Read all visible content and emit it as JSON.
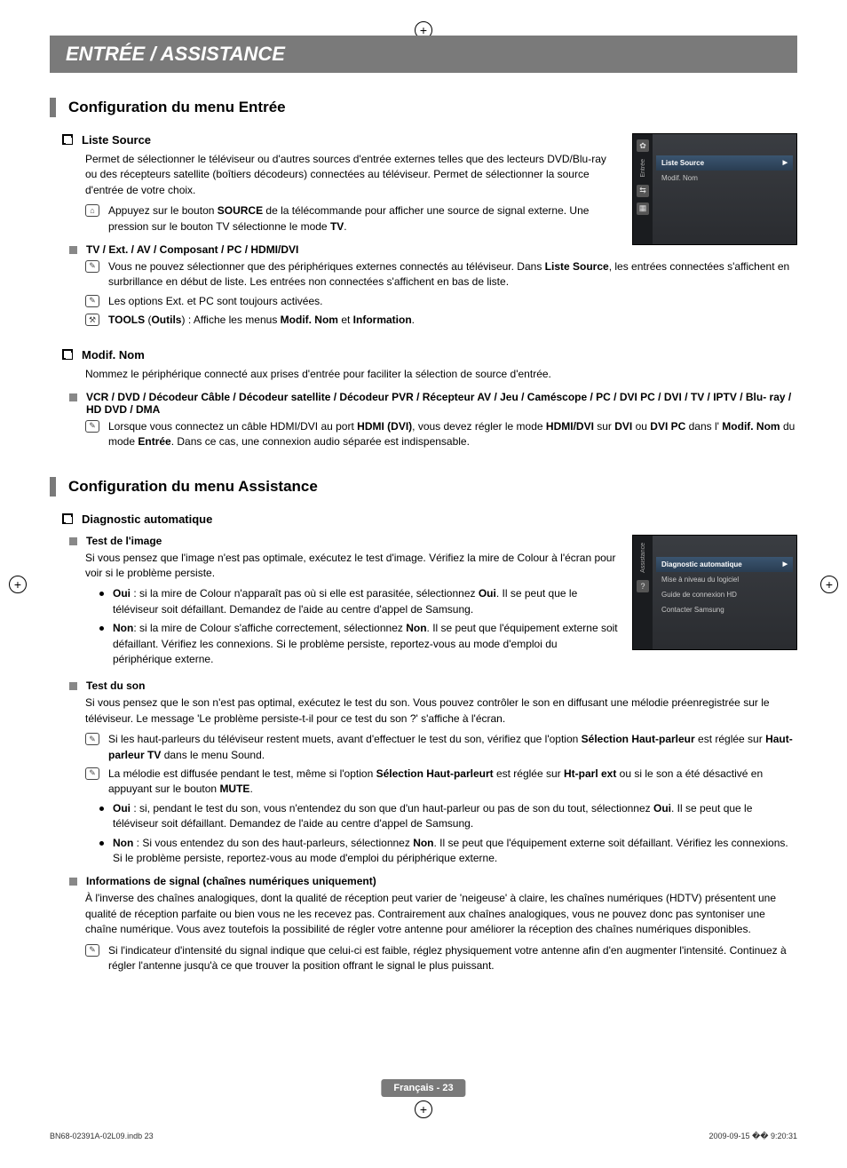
{
  "banner": "ENTRÉE / ASSISTANCE",
  "section1": {
    "title": "Configuration du menu Entrée",
    "listeSource": {
      "heading": "Liste Source",
      "intro": "Permet de sélectionner le téléviseur ou d'autres sources d'entrée externes telles que des lecteurs DVD/Blu-ray ou des récepteurs satellite (boîtiers décodeurs) connectées au téléviseur. Permet de sélectionner la source d'entrée de votre choix.",
      "note1_pre": "Appuyez sur le bouton ",
      "note1_bold": "SOURCE",
      "note1_mid": " de la télécommande pour afficher une source de signal externe. Une pression sur le bouton TV sélectionne le mode ",
      "note1_bold2": "TV",
      "note1_end": "."
    },
    "tvExt": {
      "heading": "TV / Ext. / AV / Composant / PC / HDMI/DVI",
      "note1_pre": "Vous ne pouvez sélectionner que des périphériques externes connectés au téléviseur. Dans ",
      "note1_bold": "Liste Source",
      "note1_post": ", les entrées connectées s'affichent en surbrillance en début de liste. Les entrées non connectées s'affichent en bas de liste.",
      "note2": "Les options Ext. et PC sont toujours activées.",
      "note3_b1": "TOOLS",
      "note3_p1": " (",
      "note3_b2": "Outils",
      "note3_p2": ") : Affiche les menus ",
      "note3_b3": "Modif. Nom",
      "note3_p3": " et ",
      "note3_b4": "Information",
      "note3_p4": "."
    },
    "modifNom": {
      "heading": "Modif. Nom",
      "intro": "Nommez le périphérique connecté aux prises d'entrée pour faciliter la sélection de source d'entrée.",
      "list": "VCR / DVD / Décodeur Câble / Décodeur satellite / Décodeur PVR / Récepteur AV / Jeu / Caméscope / PC / DVI PC / DVI / TV / IPTV / Blu- ray / HD DVD / DMA",
      "note_pre": "Lorsque vous connectez un câble HDMI/DVI au port ",
      "note_b1": "HDMI (DVI)",
      "note_p1": ", vous devez régler le mode ",
      "note_b2": "HDMI/DVI",
      "note_p2": " sur ",
      "note_b3": "DVI",
      "note_p3": " ou ",
      "note_b4": "DVI PC",
      "note_p4": " dans l' ",
      "note_b5": "Modif. Nom",
      "note_p5": " du mode ",
      "note_b6": "Entrée",
      "note_p6": ". Dans ce cas, une connexion audio séparée est indispensable."
    },
    "menu": {
      "tabLabel": "Entrée",
      "item1": "Liste Source",
      "item2": "Modif. Nom"
    }
  },
  "section2": {
    "title": "Configuration du menu Assistance",
    "diag": {
      "heading": "Diagnostic automatique"
    },
    "testImage": {
      "heading": "Test de l'image",
      "intro": "Si vous pensez que l'image n'est pas optimale, exécutez le test d'image. Vérifiez la mire de Colour à l'écran pour voir si le problème persiste.",
      "oui_b": "Oui",
      "oui_t": " : si la mire de Colour n'apparaît pas où si elle est parasitée, sélectionnez ",
      "oui_b2": "Oui",
      "oui_t2": ". Il se peut que le téléviseur soit défaillant. Demandez de l'aide au centre d'appel de Samsung.",
      "non_b": "Non",
      "non_t": ": si la mire de Colour s'affiche correctement, sélectionnez ",
      "non_b2": "Non",
      "non_t2": ". Il se peut que l'équipement externe soit défaillant. Vérifiez les connexions. Si le problème persiste, reportez-vous au mode d'emploi du périphérique externe."
    },
    "testSon": {
      "heading": "Test du son",
      "intro": "Si vous pensez que le son n'est pas optimal, exécutez le test du son. Vous pouvez contrôler le son en diffusant une mélodie préenregistrée sur le téléviseur. Le message 'Le problème persiste-t-il pour ce test du son ?' s'affiche à l'écran.",
      "n1_pre": "Si les haut-parleurs du téléviseur restent muets, avant d'effectuer le test du son, vérifiez que l'option ",
      "n1_b1": "Sélection Haut-parleur",
      "n1_p1": " est réglée sur ",
      "n1_b2": "Haut-parleur TV",
      "n1_p2": " dans le menu Sound.",
      "n2_pre": "La mélodie est diffusée pendant le test, même si l'option ",
      "n2_b1": "Sélection Haut-parleurt",
      "n2_p1": " est réglée sur ",
      "n2_b2": "Ht-parl ext",
      "n2_p2": " ou si le son a été désactivé en appuyant sur le bouton ",
      "n2_b3": "MUTE",
      "n2_p3": ".",
      "oui_b": "Oui",
      "oui_t": " : si, pendant le test du son, vous n'entendez du son que d'un haut-parleur ou pas de son du tout, sélectionnez ",
      "oui_b2": "Oui",
      "oui_t2": ". Il se peut que le téléviseur soit défaillant. Demandez de l'aide au centre d'appel de Samsung.",
      "non_b": "Non",
      "non_t": " : Si vous entendez du son des haut-parleurs, sélectionnez ",
      "non_b2": "Non",
      "non_t2": ". Il se peut que l'équipement externe soit défaillant. Vérifiez les connexions. Si le problème persiste, reportez-vous au mode d'emploi du périphérique externe."
    },
    "infoSignal": {
      "heading": "Informations de signal (chaînes numériques uniquement)",
      "intro": "À l'inverse des chaînes analogiques, dont la qualité de réception peut varier de 'neigeuse' à claire, les chaînes numériques (HDTV) présentent une qualité de réception parfaite ou bien vous ne les recevez pas. Contrairement aux chaînes analogiques, vous ne pouvez donc pas syntoniser une chaîne numérique. Vous avez toutefois la possibilité de régler votre antenne pour améliorer la réception des chaînes numériques disponibles.",
      "note": "Si l'indicateur d'intensité du signal indique que celui-ci est faible, réglez physiquement votre antenne afin d'en augmenter l'intensité. Continuez à régler l'antenne jusqu'à ce que trouver la position offrant le signal le plus puissant."
    },
    "menu": {
      "tabLabel": "Assistance",
      "item1": "Diagnostic automatique",
      "item2": "Mise à niveau du logiciel",
      "item3": "Guide de connexion HD",
      "item4": "Contacter Samsung"
    }
  },
  "footer": {
    "badge": "Français - 23",
    "left": "BN68-02391A-02L09.indb   23",
    "right": "2009-09-15   �� 9:20:31"
  }
}
